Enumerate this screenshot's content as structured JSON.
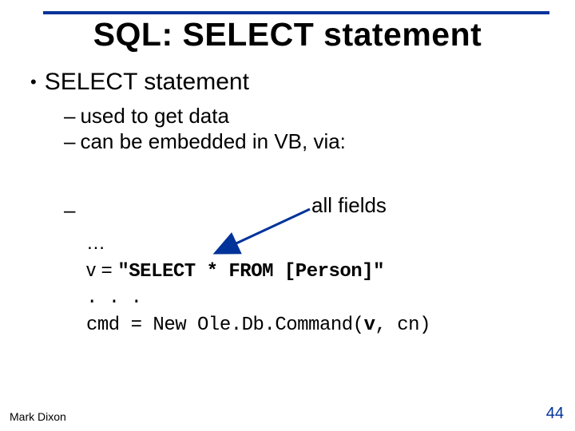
{
  "title": "SQL: SELECT statement",
  "bullets": {
    "l1": "SELECT statement",
    "l2a": "used to get data",
    "l2b": "can be embedded in VB, via:",
    "l2c_dash": "–"
  },
  "annotation": "all fields",
  "code": {
    "line1": "…",
    "line2_prefix": "v = ",
    "line2_sql": "\"SELECT * FROM [Person]\"",
    "line3": ". . .",
    "line4_prefix": "cmd = New Ole.Db.Command(",
    "line4_arg": "v",
    "line4_suffix": ", cn)"
  },
  "footer": {
    "author": "Mark Dixon",
    "page": "44"
  },
  "colors": {
    "accent": "#003399"
  }
}
